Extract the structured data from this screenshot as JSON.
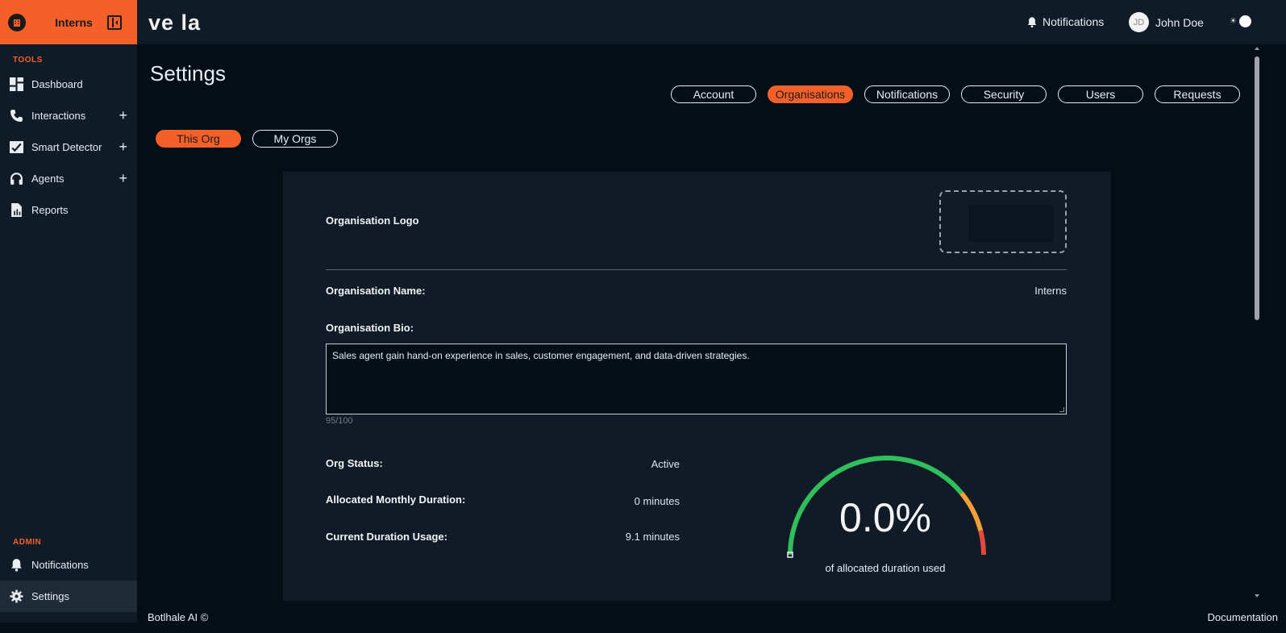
{
  "sidebar": {
    "org_name": "Interns",
    "tools_label": "TOOLS",
    "tools": [
      {
        "label": "Dashboard",
        "icon": "dashboard-icon",
        "expandable": false
      },
      {
        "label": "Interactions",
        "icon": "phone-icon",
        "expandable": true
      },
      {
        "label": "Smart Detector",
        "icon": "chart-check-icon",
        "expandable": true
      },
      {
        "label": "Agents",
        "icon": "headset-icon",
        "expandable": true
      },
      {
        "label": "Reports",
        "icon": "report-icon",
        "expandable": false
      }
    ],
    "admin_label": "ADMIN",
    "admin": [
      {
        "label": "Notifications",
        "icon": "bell-icon"
      },
      {
        "label": "Settings",
        "icon": "gear-icon",
        "active": true
      }
    ]
  },
  "topbar": {
    "logo_text": "ve la",
    "notifications_label": "Notifications",
    "user_initials": "JD",
    "user_name": "John Doe"
  },
  "page": {
    "title": "Settings",
    "tabs": [
      "Account",
      "Organisations",
      "Notifications",
      "Security",
      "Users",
      "Requests"
    ],
    "active_tab": "Organisations",
    "subtabs": [
      "This Org",
      "My Orgs"
    ],
    "active_subtab": "This Org"
  },
  "org": {
    "logo_label": "Organisation Logo",
    "name_label": "Organisation Name:",
    "name_value": "Interns",
    "bio_label": "Organisation Bio:",
    "bio_value": "Sales agent gain hand-on experience in sales, customer engagement, and data-driven strategies.",
    "bio_counter": "95/100",
    "status_label": "Org Status:",
    "status_value": "Active",
    "allocated_label": "Allocated Monthly Duration:",
    "allocated_value": "0 minutes",
    "usage_label": "Current Duration Usage:",
    "usage_value": "9.1 minutes"
  },
  "gauge": {
    "value_text": "0.0%",
    "percent": 0.0,
    "caption": "of allocated duration used",
    "colors": {
      "green": "#2fbf5b",
      "orange": "#f0a035",
      "red": "#e04a3a"
    }
  },
  "footer": {
    "left": "Botlhale AI ©",
    "right": "Documentation"
  },
  "colors": {
    "accent": "#f3602a",
    "background": "#030e17",
    "panel": "#101b27"
  }
}
